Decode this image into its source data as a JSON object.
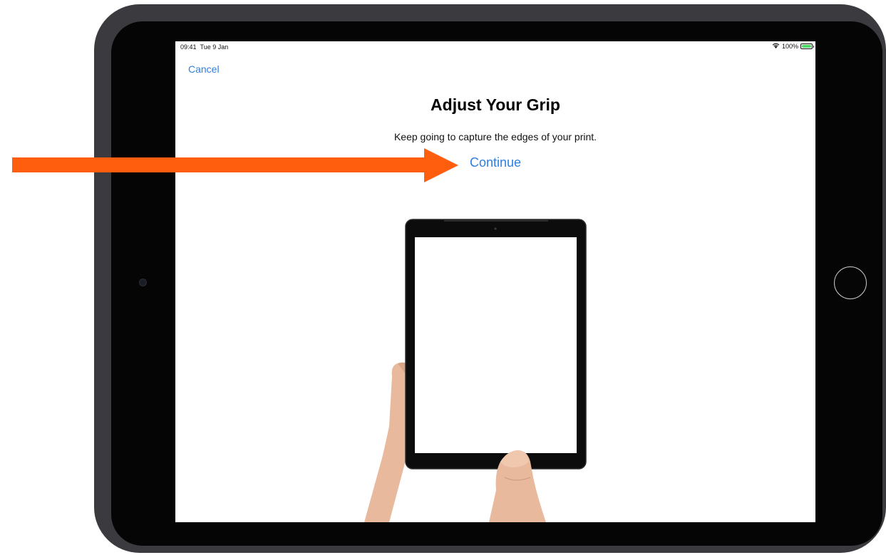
{
  "status_bar": {
    "time": "09:41",
    "date": "Tue 9 Jan",
    "battery_percent": "100%",
    "battery_level": 1.0
  },
  "nav": {
    "cancel_label": "Cancel"
  },
  "main": {
    "title": "Adjust Your Grip",
    "subtitle": "Keep going to capture the edges of your print.",
    "continue_label": "Continue"
  },
  "colors": {
    "accent": "#2f7fe0",
    "annotation_arrow": "#ff5e0e",
    "battery": "#4cd964"
  },
  "icons": {
    "wifi": "wifi-icon",
    "battery": "battery-icon",
    "arrow": "arrow-right-annotation",
    "home": "home-button",
    "camera": "front-camera"
  }
}
